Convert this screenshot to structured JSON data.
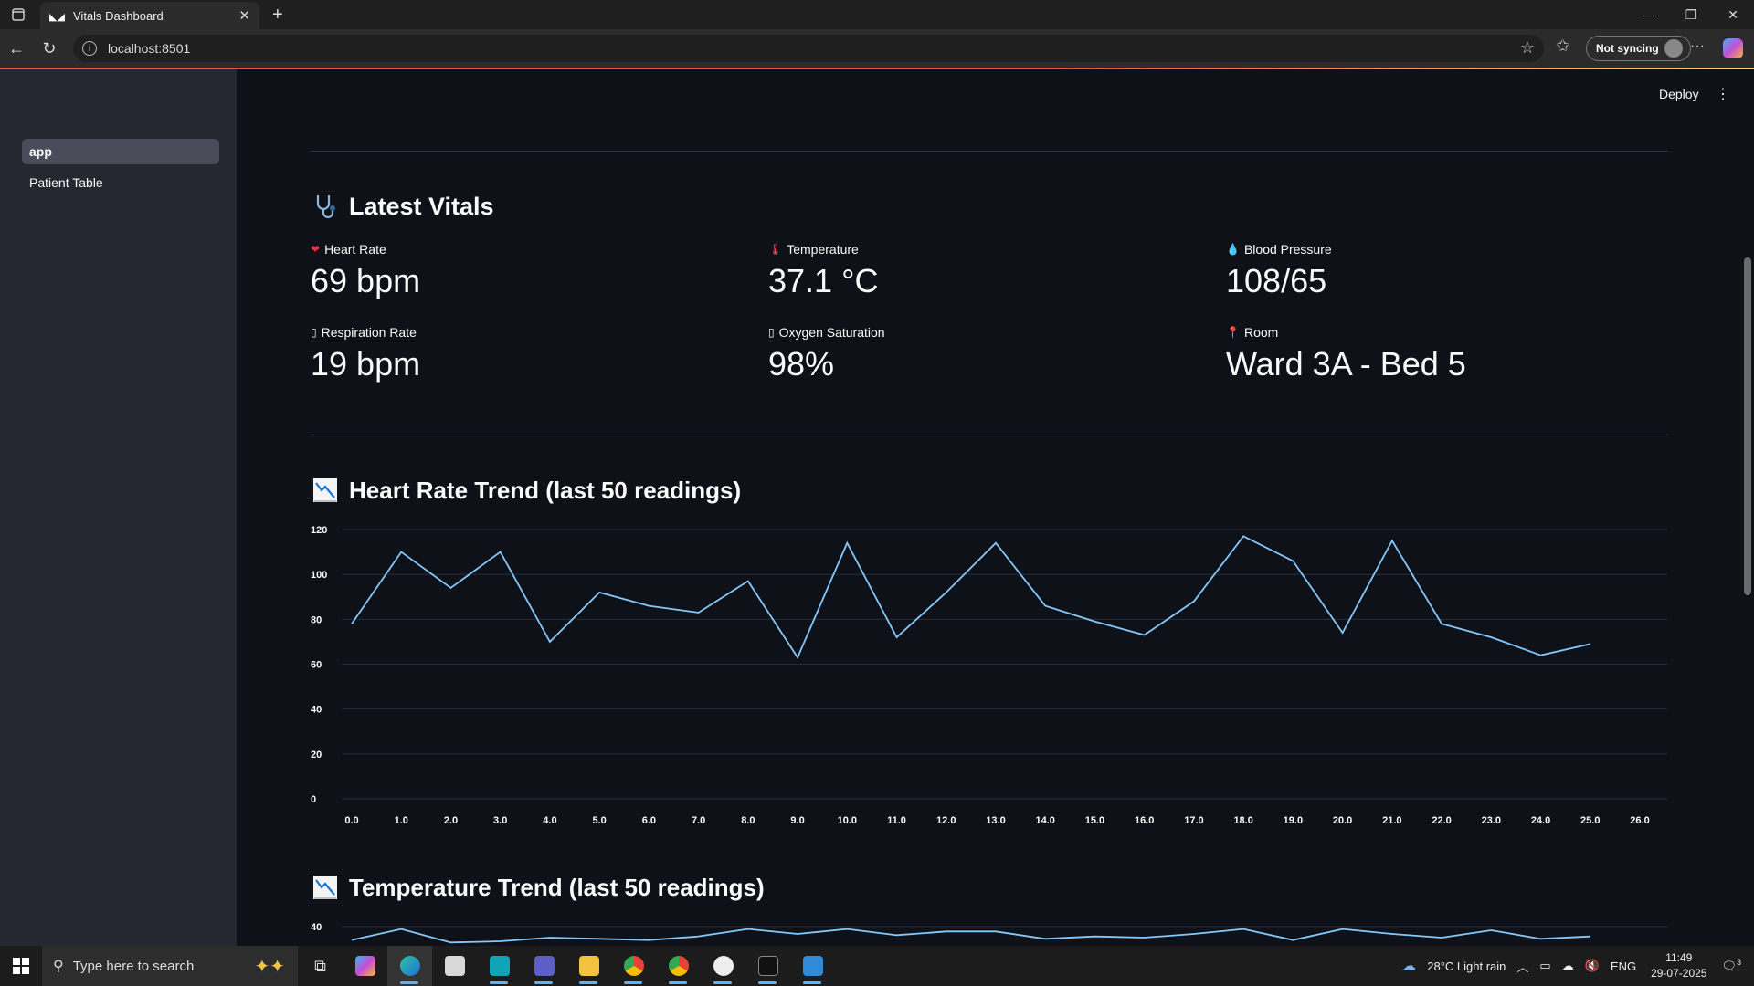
{
  "browser": {
    "tab_title": "Vitals Dashboard",
    "url": "localhost:8501",
    "sync_label": "Not syncing"
  },
  "sidebar": {
    "items": [
      {
        "label": "app",
        "active": true
      },
      {
        "label": "Patient Table",
        "active": false
      }
    ]
  },
  "header": {
    "deploy_label": "Deploy"
  },
  "vitals": {
    "title": "Latest Vitals",
    "metrics": [
      {
        "label": "Heart Rate",
        "value": "69 bpm",
        "icon": "heart-icon"
      },
      {
        "label": "Temperature",
        "value": "37.1 °C",
        "icon": "thermometer-icon"
      },
      {
        "label": "Blood Pressure",
        "value": "108/65",
        "icon": "drop-icon"
      },
      {
        "label": "Respiration Rate",
        "value": "19 bpm",
        "icon": "missing-glyph-icon"
      },
      {
        "label": "Oxygen Saturation",
        "value": "98%",
        "icon": "missing-glyph-icon"
      },
      {
        "label": "Room",
        "value": "Ward 3A - Bed 5",
        "icon": "pin-icon"
      }
    ]
  },
  "hr_chart_title": "Heart Rate Trend (last 50 readings)",
  "temp_chart_title": "Temperature Trend (last 50 readings)",
  "chart_data": [
    {
      "type": "line",
      "title": "Heart Rate Trend (last 50 readings)",
      "x": [
        0,
        1,
        2,
        3,
        4,
        5,
        6,
        7,
        8,
        9,
        10,
        11,
        12,
        13,
        14,
        15,
        16,
        17,
        18,
        19,
        20,
        21,
        22,
        23,
        24,
        25
      ],
      "y": [
        78,
        110,
        94,
        110,
        70,
        92,
        86,
        83,
        97,
        63,
        114,
        72,
        92,
        114,
        86,
        79,
        73,
        88,
        117,
        106,
        74,
        115,
        78,
        72,
        64,
        69
      ],
      "xlim": [
        0,
        26
      ],
      "ylim": [
        0,
        120
      ],
      "x_ticks": [
        "0.0",
        "1.0",
        "2.0",
        "3.0",
        "4.0",
        "5.0",
        "6.0",
        "7.0",
        "8.0",
        "9.0",
        "10.0",
        "11.0",
        "12.0",
        "13.0",
        "14.0",
        "15.0",
        "16.0",
        "17.0",
        "18.0",
        "19.0",
        "20.0",
        "21.0",
        "22.0",
        "23.0",
        "24.0",
        "25.0",
        "26.0"
      ],
      "y_ticks": [
        "0",
        "20",
        "40",
        "60",
        "80",
        "100",
        "120"
      ],
      "color": "#83c9ff",
      "grid": true
    },
    {
      "type": "line",
      "title": "Temperature Trend (last 50 readings)",
      "x": [
        0,
        1,
        2,
        3,
        4,
        5,
        6,
        7,
        8,
        9,
        10,
        11,
        12,
        13,
        14,
        15,
        16,
        17,
        18,
        19,
        20,
        21,
        22,
        23,
        24,
        25
      ],
      "y": [
        36.9,
        37.8,
        36.7,
        36.8,
        37.1,
        37.0,
        36.9,
        37.2,
        37.8,
        37.4,
        37.8,
        37.3,
        37.6,
        37.6,
        37.0,
        37.2,
        37.1,
        37.4,
        37.8,
        36.9,
        37.8,
        37.4,
        37.1,
        37.7,
        37.0,
        37.2
      ],
      "xlim": [
        0,
        26
      ],
      "y_ticks_visible": [
        "40"
      ],
      "color": "#83c9ff"
    }
  ],
  "taskbar": {
    "search_placeholder": "Type here to search",
    "weather": "28°C  Light rain",
    "lang": "ENG",
    "time": "11:49",
    "date": "29-07-2025",
    "notif_count": "3",
    "weather_badge": "3"
  },
  "colors": {
    "background": "#0e1117",
    "sidebar": "#262730",
    "line": "#83c9ff",
    "accent": "#ff4b4b"
  }
}
